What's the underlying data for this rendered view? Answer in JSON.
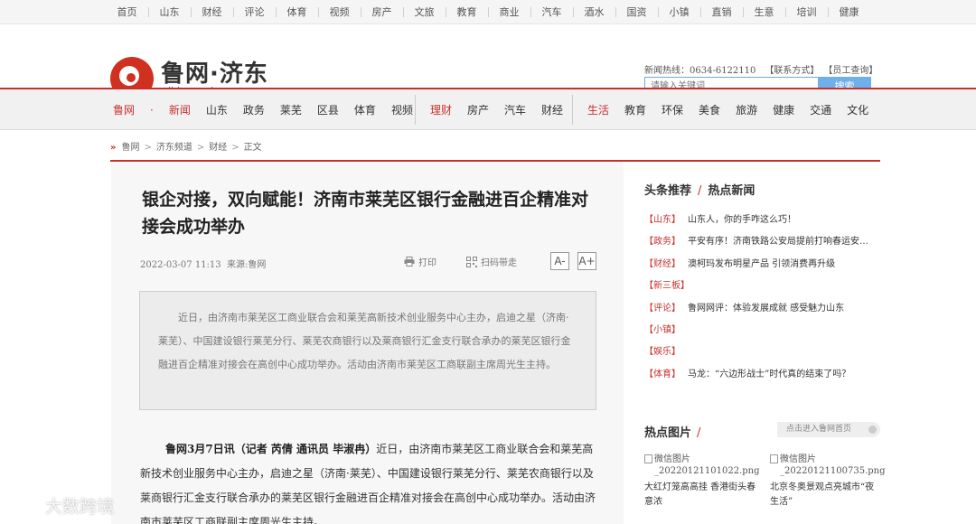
{
  "top_nav": [
    "首页",
    "山东",
    "财经",
    "评论",
    "体育",
    "视频",
    "房产",
    "文旅",
    "教育",
    "商业",
    "汽车",
    "酒水",
    "国资",
    "小镇",
    "直销",
    "生意",
    "培训",
    "健康"
  ],
  "header": {
    "logo_text": "鲁网·济东",
    "logo_url": "jidong.sdnews.com.cn",
    "hotline": "新闻热线：0634-6122110",
    "contact": "【联系方式】",
    "staff": "【员工查询】",
    "search_placeholder": "请输入关键词",
    "search_button": "搜索"
  },
  "main_nav": {
    "group1": [
      "鲁网",
      "·",
      "新闻",
      "山东",
      "政务",
      "莱芜",
      "区县",
      "体育",
      "视频"
    ],
    "group2": [
      "理财",
      "房产",
      "汽车",
      "财经"
    ],
    "group3": [
      "生活",
      "教育",
      "环保",
      "美食",
      "旅游",
      "健康",
      "交通",
      "文化"
    ]
  },
  "breadcrumb": [
    "鲁网",
    "济东频道",
    "财经",
    "正文"
  ],
  "article": {
    "title": "银企对接，双向赋能！济南市莱芜区银行金融进百企精准对接会成功举办",
    "date": "2022-03-07 11:13",
    "source": "来源:鲁网",
    "print_label": "打印",
    "scan_label": "扫码带走",
    "font_smaller": "A-",
    "font_larger": "A+",
    "summary": "近日，由济南市莱芜区工商业联合会和莱芜高新技术创业服务中心主办，启迪之星（济南·莱芜）、中国建设银行莱芜分行、莱芜农商银行以及莱商银行汇金支行联合承办的莱芜区银行金融进百企精准对接会在高创中心成功举办。活动由济南市莱芜区工商联副主席周光生主持。",
    "lead": "鲁网3月7日讯（记者 芮倩 通讯员 毕淑冉）",
    "body": "近日，由济南市莱芜区工商业联合会和莱芜高新技术创业服务中心主办，启迪之星（济南·莱芜）、中国建设银行莱芜分行、莱芜农商银行以及莱商银行汇金支行联合承办的莱芜区银行金融进百企精准对接会在高创中心成功举办。活动由济南市莱芜区工商联副主席周光生主持。"
  },
  "sidebar": {
    "title_left": "头条推荐",
    "title_right": "热点新闻",
    "news": [
      {
        "tag": "【山东】",
        "text": "山东人，你的手咋这么巧！"
      },
      {
        "tag": "【政务】",
        "text": "平安有序！济南铁路公安局提前打响春运安…"
      },
      {
        "tag": "【财经】",
        "text": "澳柯玛发布明星产品 引领消费再升级"
      },
      {
        "tag": "【新三板】",
        "text": ""
      },
      {
        "tag": "【评论】",
        "text": "鲁网网评：体验发展成就 感受魅力山东"
      },
      {
        "tag": "【小镇】",
        "text": ""
      },
      {
        "tag": "【娱乐】",
        "text": ""
      },
      {
        "tag": "【体育】",
        "text": "马龙：“六边形战士”时代真的结束了吗？"
      }
    ],
    "hot_pics_title": "热点图片",
    "hot_pics_link": "点击进入鲁网首页",
    "pics": [
      {
        "alt": "微信图片_20220121101022.png",
        "caption": "大红灯笼高高挂 香港街头春意浓"
      },
      {
        "alt": "微信图片_20220121100735.png",
        "caption": "北京冬奥景观点亮城市“夜生活”"
      }
    ]
  },
  "watermark": "大数跨境"
}
